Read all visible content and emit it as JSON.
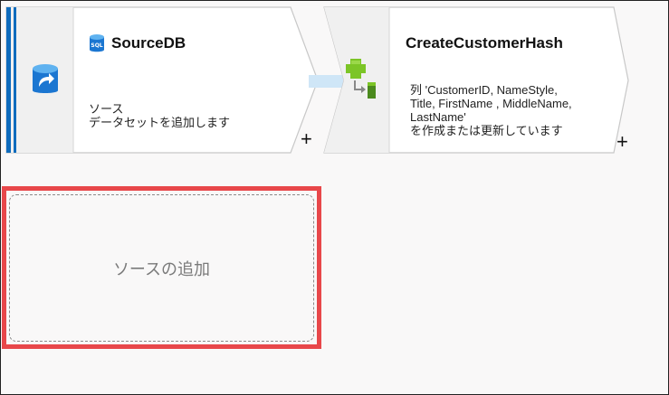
{
  "nodes": [
    {
      "title": "SourceDB",
      "title_icon": "sql-database-icon",
      "main_icon": "dataset-source-icon",
      "desc_line1": "ソース",
      "desc_line2": "データセットを追加します",
      "add_label": "+"
    },
    {
      "title": "CreateCustomerHash",
      "main_icon": "derived-column-icon",
      "desc_line1": "列 'CustomerID, NameStyle,",
      "desc_line2": "Title, FirstName , MiddleName,",
      "desc_line3": "LastName'",
      "desc_line4": "を作成または更新しています",
      "add_label": "+"
    }
  ],
  "add_source": {
    "label": "ソースの追加"
  },
  "colors": {
    "accent_blue": "#0f6cbd",
    "highlight_red": "#e8474a",
    "connector": "#cfe6f7",
    "transform_green": "#7cc527"
  }
}
